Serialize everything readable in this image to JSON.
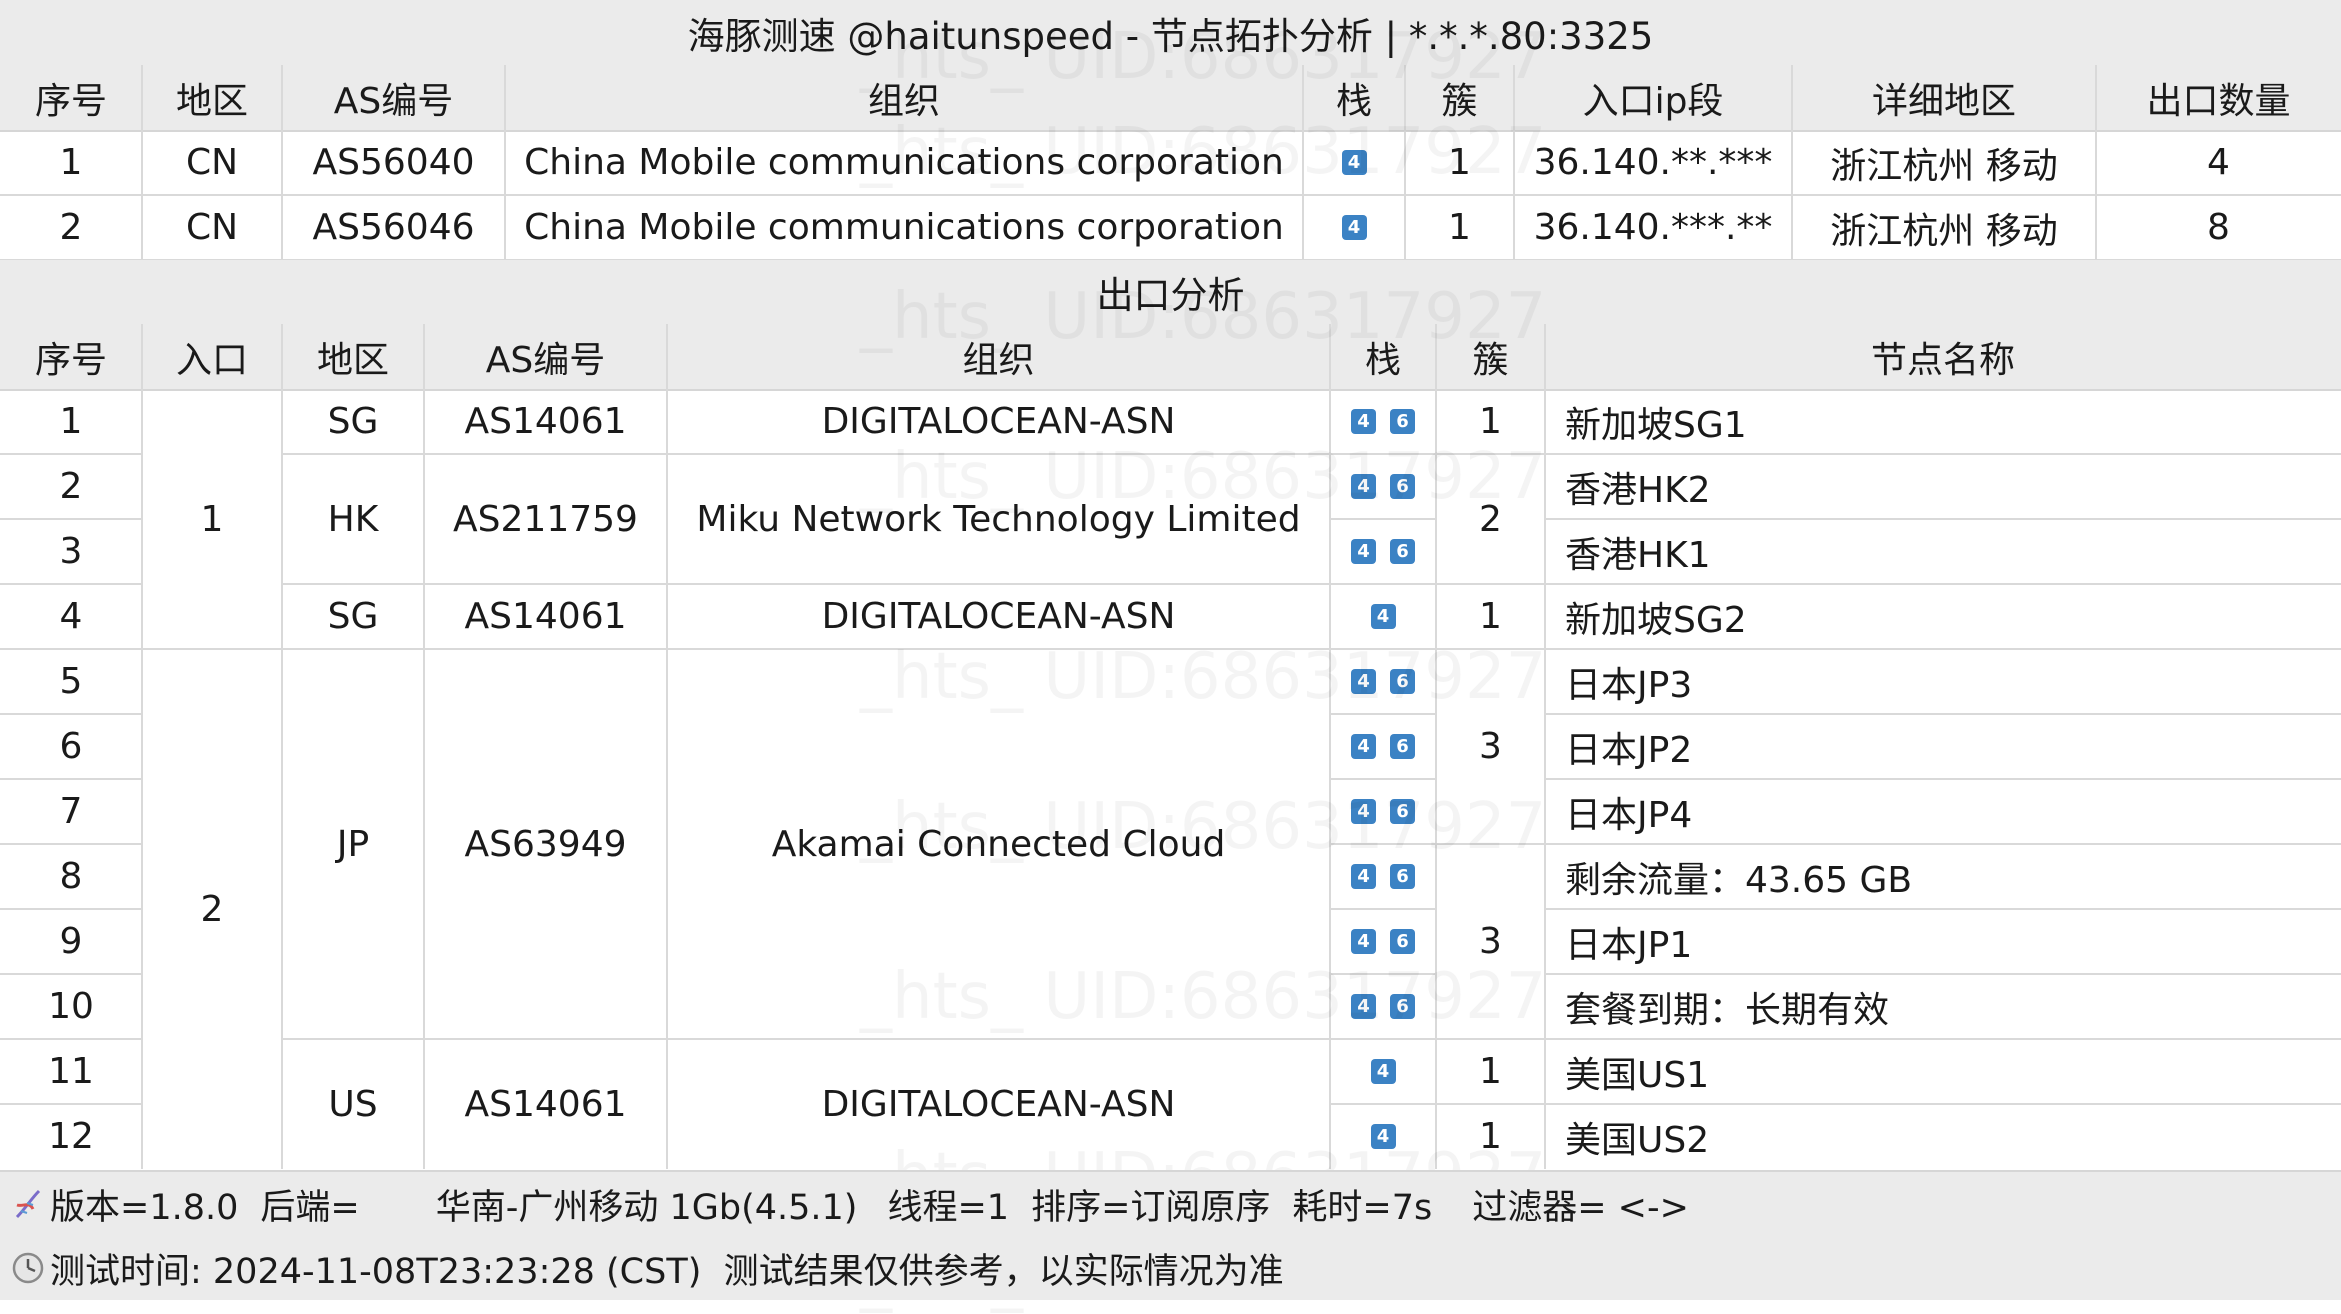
{
  "title": "海豚测速 @haitunspeed - 节点拓扑分析 | *.*.*.80:3325",
  "entry": {
    "headers": [
      "序号",
      "地区",
      "AS编号",
      "组织",
      "栈",
      "簇",
      "入口ip段",
      "详细地区",
      "出口数量"
    ],
    "rows": [
      {
        "no": "1",
        "region": "CN",
        "asn": "AS56040",
        "org": "China Mobile communications corporation",
        "stack": [
          "4"
        ],
        "cluster": "1",
        "ip": "36.140.**.***",
        "detail": "浙江杭州 移动",
        "count": "4"
      },
      {
        "no": "2",
        "region": "CN",
        "asn": "AS56046",
        "org": "China Mobile communications corporation",
        "stack": [
          "4"
        ],
        "cluster": "1",
        "ip": "36.140.***.**",
        "detail": "浙江杭州 移动",
        "count": "8"
      }
    ]
  },
  "exit": {
    "title": "出口分析",
    "headers": [
      "序号",
      "入口",
      "地区",
      "AS编号",
      "组织",
      "栈",
      "簇",
      "节点名称"
    ],
    "numbers": [
      "1",
      "2",
      "3",
      "4",
      "5",
      "6",
      "7",
      "8",
      "9",
      "10",
      "11",
      "12"
    ],
    "entries": [
      "1",
      "2"
    ],
    "regions": [
      "SG",
      "HK",
      "SG",
      "JP",
      "US"
    ],
    "asns": [
      "AS14061",
      "AS211759",
      "AS14061",
      "AS63949",
      "AS14061"
    ],
    "orgs": [
      "DIGITALOCEAN-ASN",
      "Miku Network Technology Limited",
      "DIGITALOCEAN-ASN",
      "Akamai Connected Cloud",
      "DIGITALOCEAN-ASN"
    ],
    "stacks": [
      [
        "4",
        "6"
      ],
      [
        "4",
        "6"
      ],
      [
        "4",
        "6"
      ],
      [
        "4"
      ],
      [
        "4",
        "6"
      ],
      [
        "4",
        "6"
      ],
      [
        "4",
        "6"
      ],
      [
        "4",
        "6"
      ],
      [
        "4",
        "6"
      ],
      [
        "4",
        "6"
      ],
      [
        "4"
      ],
      [
        "4"
      ]
    ],
    "clusters": [
      "1",
      "2",
      "1",
      "3",
      "3",
      "1",
      "1"
    ],
    "names": [
      "新加坡SG1",
      "香港HK2",
      "香港HK1",
      "新加坡SG2",
      "日本JP3",
      "日本JP2",
      "日本JP4",
      "剩余流量：43.65 GB",
      "日本JP1",
      "套餐到期：长期有效",
      "美国US1",
      "美国US2"
    ]
  },
  "footer": {
    "version": "版本=1.8.0",
    "backend": "后端=",
    "location": "华南-广州移动 1Gb(4.5.1)",
    "threads": "线程=1",
    "sort": "排序=订阅原序",
    "elapsed": "耗时=7s",
    "filter": "过滤器= <->",
    "test_time": "测试时间: 2024-11-08T23:23:28 (CST)  测试结果仅供参考，以实际情况为准"
  },
  "watermark": "_hts_ UID:686317927",
  "colors": {
    "badge": "#3b82c4",
    "header_bg": "#ebebeb",
    "grid": "#d9d9d9"
  },
  "icons": {
    "footer1": "dna-icon",
    "footer2": "clock-icon"
  }
}
